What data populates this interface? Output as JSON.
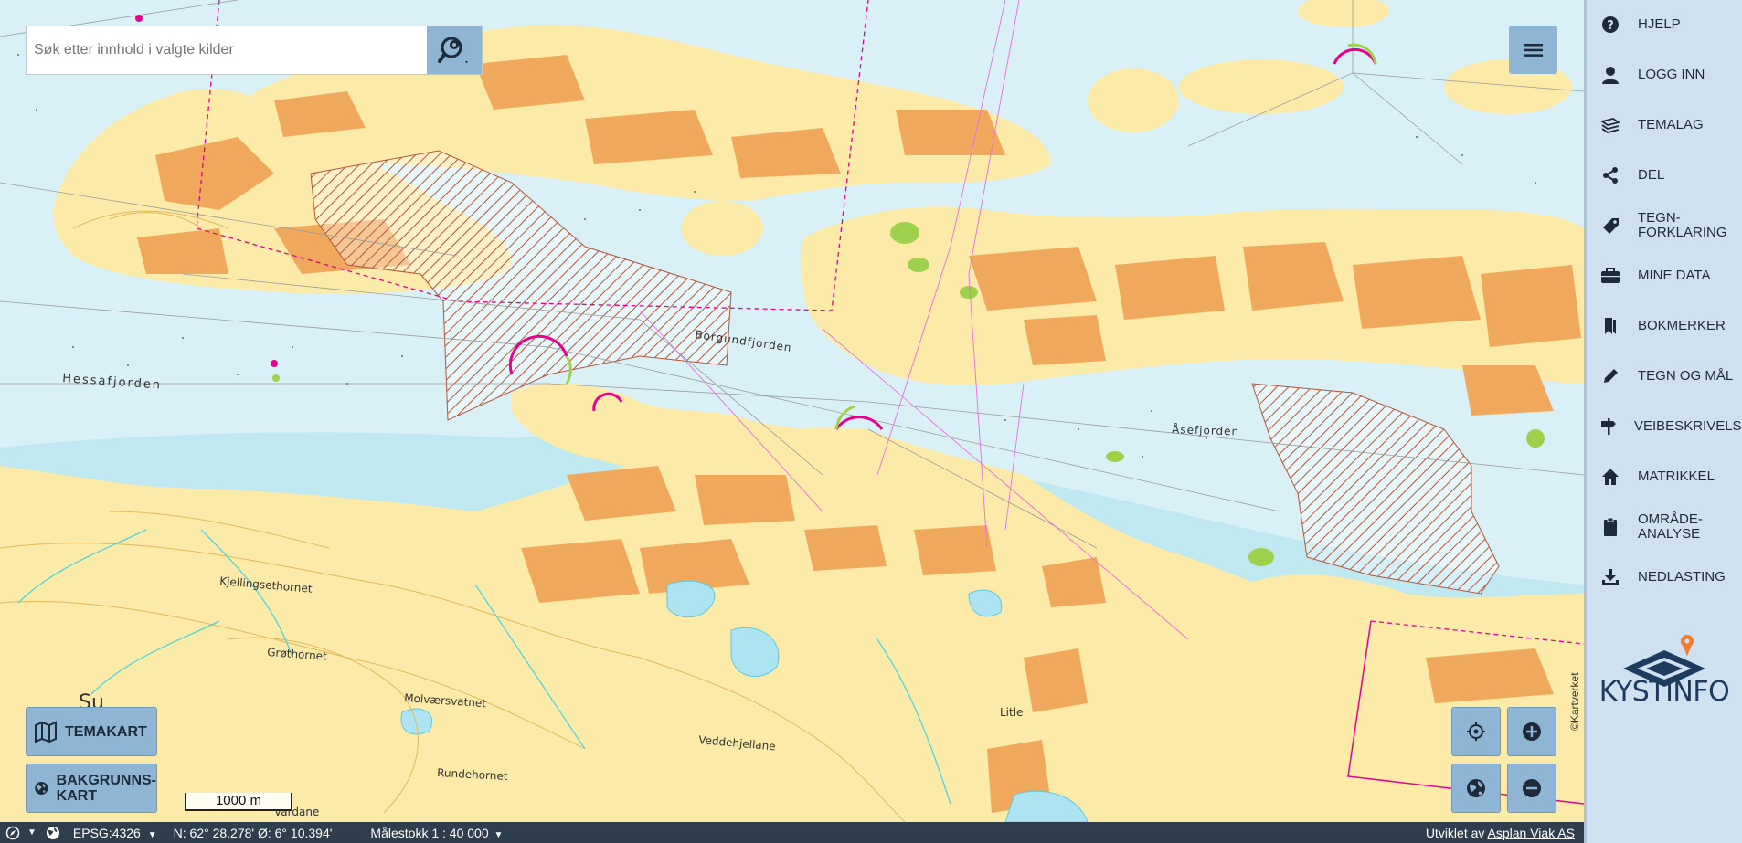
{
  "search": {
    "placeholder": "Søk etter innhold i valgte kilder",
    "value": ""
  },
  "sidebar": {
    "items": [
      {
        "label": "HJELP",
        "icon": "help-icon"
      },
      {
        "label": "LOGG INN",
        "icon": "user-icon"
      },
      {
        "label": "TEMALAG",
        "icon": "layers-icon"
      },
      {
        "label": "DEL",
        "icon": "share-icon"
      },
      {
        "label": "TEGN-\nFORKLARING",
        "icon": "tag-icon"
      },
      {
        "label": "MINE DATA",
        "icon": "briefcase-icon"
      },
      {
        "label": "BOKMERKER",
        "icon": "bookmark-icon"
      },
      {
        "label": "TEGN OG MÅL",
        "icon": "pencil-icon"
      },
      {
        "label": "VEIBESKRIVELSE",
        "icon": "signpost-icon"
      },
      {
        "label": "MATRIKKEL",
        "icon": "home-icon"
      },
      {
        "label": "OMRÅDE-\nANALYSE",
        "icon": "clipboard-icon"
      },
      {
        "label": "NEDLASTING",
        "icon": "download-icon"
      }
    ],
    "logo_text": "KYSTINFO"
  },
  "map_buttons": {
    "temakart": "TEMAKART",
    "bakgrunnskart": "BAKGRUNNS-\nKART"
  },
  "scale_bar": "1000 m",
  "attribution": "©Kartverket",
  "statusbar": {
    "projection": "EPSG:4326",
    "coordinates": "N: 62° 28.278' Ø: 6° 10.394'",
    "scale": "Målestokk 1 : 40 000",
    "credit_prefix": "Utviklet av",
    "credit_link": "Asplan Viak AS"
  },
  "map_labels": {
    "hessafjorden": "Hessafjorden",
    "borgundfjorden": "Borgundfjorden",
    "aasefjorden": "Åsefjorden",
    "kjellingsethornet": "Kjellingsethornet",
    "grothornet": "Grøthornet",
    "molvaersvatnet": "Molværsvatnet",
    "veddehjellane": "Veddehjellane",
    "rundehornet": "Rundehornet",
    "vardane": "Vardane",
    "su": "Su",
    "litle": "Litle"
  },
  "colors": {
    "sea": "#d9f1f6",
    "land": "#fbeaa8",
    "built_up": "#f0a95c",
    "forest": "#9fd04b",
    "boundary": "#e6008e",
    "panel": "#8eb6d4",
    "sidebar": "#cfe0ef",
    "statusbar": "#2f3e4d"
  }
}
